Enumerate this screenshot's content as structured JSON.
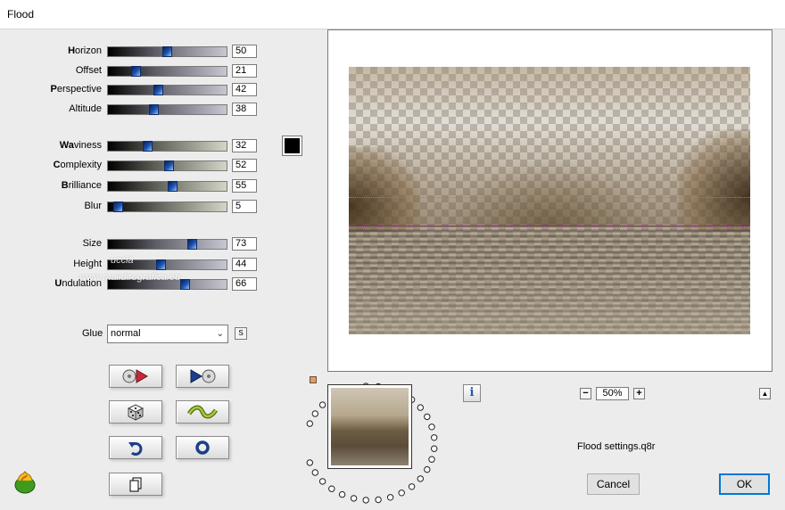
{
  "window": {
    "title": "Flood"
  },
  "sliders": [
    {
      "key": "horizon",
      "pre": "H",
      "rest": "orizon",
      "value": "50",
      "pos": 50,
      "track": "blue"
    },
    {
      "key": "offset",
      "pre": "",
      "rest": "Offset",
      "value": "21",
      "pos": 21,
      "track": "blue"
    },
    {
      "key": "perspective",
      "pre": "P",
      "rest": "erspective",
      "value": "42",
      "pos": 42,
      "track": "blue"
    },
    {
      "key": "altitude",
      "pre": "",
      "rest": "Altitude",
      "value": "38",
      "pos": 38,
      "track": "blue"
    },
    {
      "key": "waviness",
      "pre": "Wa",
      "rest": "viness",
      "value": "32",
      "pos": 32,
      "track": "green"
    },
    {
      "key": "complexity",
      "pre": "C",
      "rest": "omplexity",
      "value": "52",
      "pos": 52,
      "track": "green"
    },
    {
      "key": "brilliance",
      "pre": "B",
      "rest": "rilliance",
      "value": "55",
      "pos": 55,
      "track": "green"
    },
    {
      "key": "blur",
      "pre": "",
      "rest": "Blur",
      "value": "5",
      "pos": 5,
      "track": "green"
    },
    {
      "key": "size",
      "pre": "",
      "rest": "Size",
      "value": "73",
      "pos": 73,
      "track": "blue"
    },
    {
      "key": "height",
      "pre": "",
      "rest": "Height",
      "value": "44",
      "pos": 44,
      "track": "blue"
    },
    {
      "key": "undulation",
      "pre": "U",
      "rest": "ndulation",
      "value": "66",
      "pos": 66,
      "track": "blue"
    }
  ],
  "color": {
    "swatch": "#000000"
  },
  "glue": {
    "label": "Glue",
    "selected": "normal",
    "s_label": "S"
  },
  "watermark": {
    "line1": "uccia",
    "line2": "www.maildiregrafica.eu"
  },
  "zoom": {
    "value": "50%",
    "minus": "−",
    "plus": "+"
  },
  "info": {
    "label": "i"
  },
  "collapse": {
    "label": "▲"
  },
  "settings": {
    "filename": "Flood settings.q8r"
  },
  "buttons": {
    "cancel": "Cancel",
    "ok": "OK"
  }
}
